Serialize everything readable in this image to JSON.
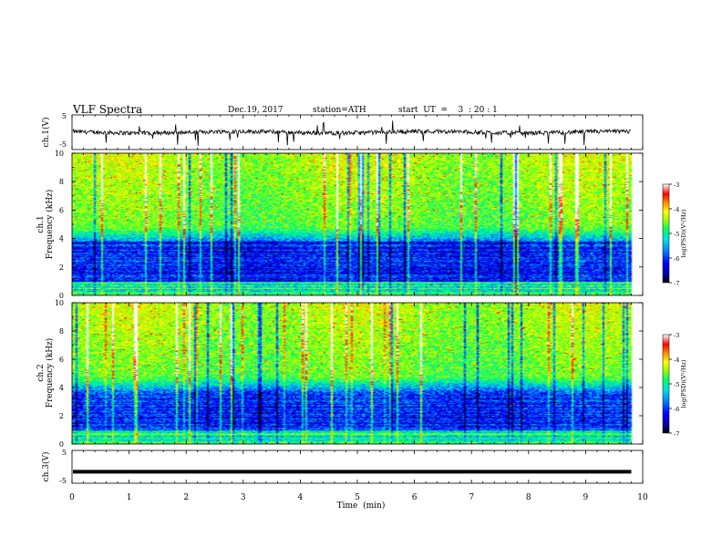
{
  "header": {
    "title": "VLF  Spectra",
    "date": "Dec.19, 2017",
    "station": "station=ATH",
    "start_ut": "start  UT  =    3  : 20 : 1"
  },
  "chart_data": [
    {
      "type": "line",
      "panel": "ch1-waveform",
      "ylabel": "ch.1(V)",
      "ylim": [
        -5,
        5
      ],
      "y_ticks": [
        "5",
        "-5"
      ],
      "xlim": [
        0,
        10
      ],
      "series": [
        {
          "trace": "noisy waveform around 0 V with sparse negative spikes to about -2 V"
        }
      ]
    },
    {
      "type": "heatmap",
      "panel": "ch1-spectrogram",
      "ylabel_line1": "ch.1",
      "ylabel_line2": "Frequency  (kHz)",
      "ylim": [
        0,
        10
      ],
      "y_ticks": [
        "0",
        "2",
        "4",
        "6",
        "8",
        "10"
      ],
      "xlim": [
        0,
        10
      ],
      "data_extent_min": 9.8,
      "colorbar": {
        "label": "log(PSD)(V²/Hz)",
        "range": [
          -7,
          -3
        ],
        "ticks": [
          "-3",
          "-4",
          "-5",
          "-6",
          "-7"
        ]
      }
    },
    {
      "type": "heatmap",
      "panel": "ch2-spectrogram",
      "ylabel_line1": "ch.2",
      "ylabel_line2": "Frequency  (kHz)",
      "ylim": [
        0,
        10
      ],
      "y_ticks": [
        "0",
        "2",
        "4",
        "6",
        "8",
        "10"
      ],
      "xlim": [
        0,
        10
      ],
      "data_extent_min": 9.8,
      "colorbar": {
        "label": "log(PSD)(V²/Hz)",
        "range": [
          -7,
          -3
        ],
        "ticks": [
          "-3",
          "-4",
          "-5",
          "-6",
          "-7"
        ]
      }
    },
    {
      "type": "line",
      "panel": "ch3-waveform",
      "ylabel": "ch.3(V)",
      "ylim": [
        -5,
        5
      ],
      "y_ticks": [
        "5",
        "-5"
      ],
      "xlim": [
        0,
        10
      ],
      "series": [
        {
          "trace": "thick flat line at about -1.5 V"
        }
      ]
    }
  ],
  "x_axis": {
    "label": "Time  (min)",
    "ticks": [
      "0",
      "1",
      "2",
      "3",
      "4",
      "5",
      "6",
      "7",
      "8",
      "9",
      "10"
    ]
  },
  "colors": {
    "colormap": [
      "#000000",
      "#0000a0",
      "#0000ff",
      "#0080ff",
      "#00e0e0",
      "#00ff60",
      "#a0ff00",
      "#ffff00",
      "#ff8000",
      "#ff0000",
      "#ffffff"
    ]
  }
}
